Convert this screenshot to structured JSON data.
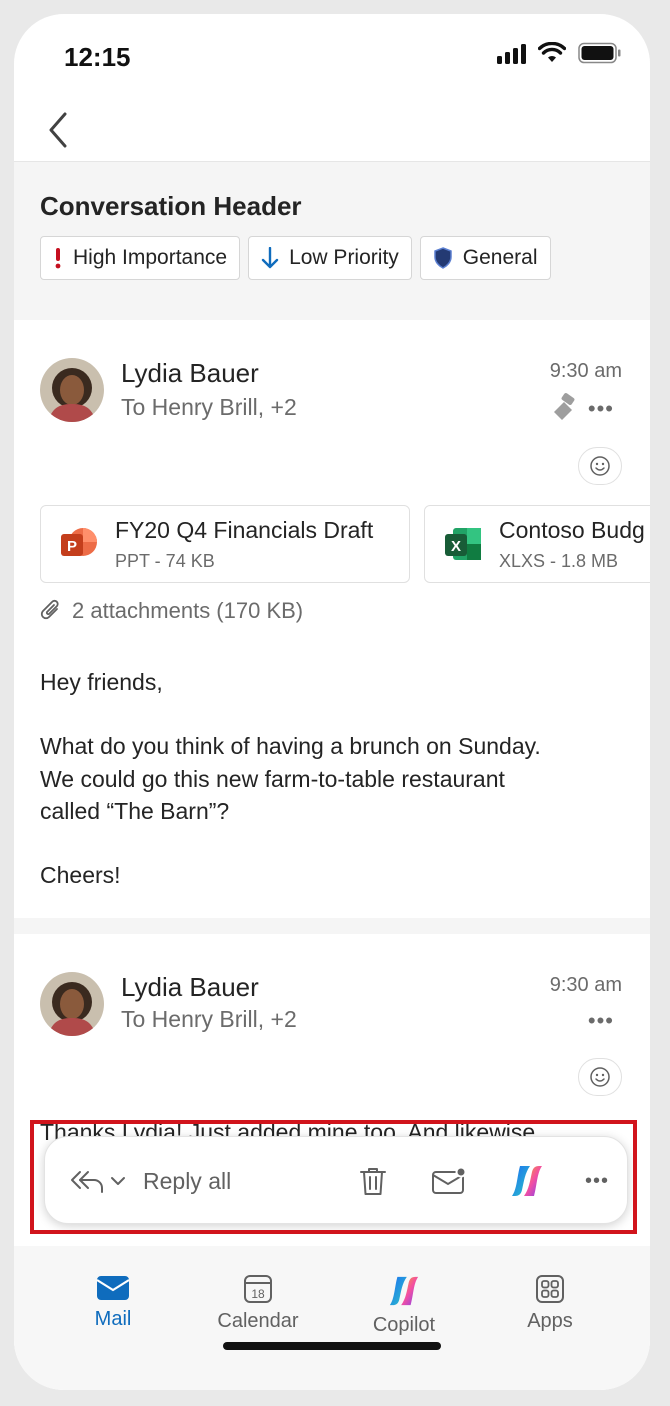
{
  "status_bar": {
    "time": "12:15"
  },
  "conversation": {
    "title": "Conversation Header",
    "chips": [
      {
        "label": "High Importance",
        "icon": "exclamation-icon"
      },
      {
        "label": "Low Priority",
        "icon": "arrow-down-icon"
      },
      {
        "label": "General",
        "icon": "shield-icon"
      }
    ]
  },
  "messages": [
    {
      "sender": "Lydia Bauer",
      "recipients": "To Henry Brill, +2",
      "time": "9:30 am",
      "attachments": [
        {
          "name": "FY20 Q4 Financials Draft",
          "meta": "PPT - 74 KB",
          "type": "powerpoint"
        },
        {
          "name": "Contoso Budg",
          "meta": "XLXS - 1.8 MB",
          "type": "excel"
        }
      ],
      "attachment_summary": "2 attachments (170 KB)",
      "body": [
        "Hey friends,",
        "What do you think of having a brunch on Sunday.",
        "We could go this new farm-to-table restaurant",
        "called “The Barn”?",
        "Cheers!"
      ]
    },
    {
      "sender": "Lydia Bauer",
      "recipients": "To Henry Brill, +2",
      "time": "9:30 am",
      "body_partial": "Thanks Lydia! Just added mine too. And likewise,"
    }
  ],
  "action_bar": {
    "reply_label": "Reply all",
    "more": "•••"
  },
  "tabbar": {
    "tabs": [
      {
        "label": "Mail",
        "active": true
      },
      {
        "label": "Calendar",
        "active": false,
        "day": "18"
      },
      {
        "label": "Copilot",
        "active": false
      },
      {
        "label": "Apps",
        "active": false
      }
    ]
  },
  "colors": {
    "accent": "#0f6cbd",
    "highlight": "#d1141c",
    "importance": "#c50f1f",
    "shield": "#243a73"
  }
}
